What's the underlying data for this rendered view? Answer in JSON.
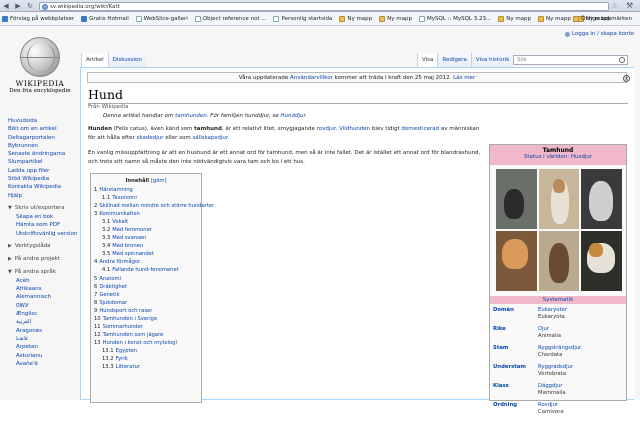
{
  "browser": {
    "url": "sv.wikipedia.org/wiki/Katt",
    "bookmarks": [
      {
        "label": "Förslag på webbplatser",
        "icon": "blue"
      },
      {
        "label": "Gratis Hotmail",
        "icon": "blue"
      },
      {
        "label": "WebSlice-galleri",
        "icon": "page"
      },
      {
        "label": "Object reference not ...",
        "icon": "page"
      },
      {
        "label": "Personlig startsida",
        "icon": "page"
      },
      {
        "label": "Ny mapp",
        "icon": "folder"
      },
      {
        "label": "Ny mapp",
        "icon": "folder"
      },
      {
        "label": "MySQL :: MySQL 3.23...",
        "icon": "page"
      },
      {
        "label": "Ny mapp",
        "icon": "folder"
      },
      {
        "label": "Ny mapp",
        "icon": "folder"
      },
      {
        "label": "Ny mapp",
        "icon": "folder"
      }
    ],
    "other_bookmarks": "Övriga bokmärken"
  },
  "wiki": {
    "personal_link": "Logga in / skapa konto",
    "logo_title": "WIKIPEDIA",
    "logo_subtitle": "Den fria encyklopedin",
    "nav": [
      "Huvudsida",
      "Bikt om en artikel",
      "Deltagarportalen",
      "Bybrunnen",
      "Senaste ändringarna",
      "Slumpartikel",
      "Ladda upp filer",
      "Stöd Wikipedia",
      "Kontakta Wikipedia",
      "Hjälp"
    ],
    "print_section": "Skriv ut/exportera",
    "print_items": [
      "Skapa en bok",
      "Hämta som PDF",
      "Utskriftsvänlig version"
    ],
    "tools_section": "Verktygslåda",
    "projects_section": "På andra projekt",
    "languages_section": "På andra språk",
    "languages": [
      "Acèh",
      "Afrikaans",
      "Alemannisch",
      "ᏣᎳᎩ",
      "Ænglisc",
      "العربية",
      "Aragonés",
      "ܐܪܡܝܐ",
      "Arpetan",
      "Asturianu",
      "Avañe'ẽ"
    ],
    "tabs_left": [
      "Artikel",
      "Diskussion"
    ],
    "tabs_right": [
      "Visa",
      "Redigera",
      "Visa historik"
    ],
    "search_placeholder": "Sök",
    "site_notice_pre": "Våra uppdaterade ",
    "site_notice_link": "Användarvillkor",
    "site_notice_mid": " kommer att träda i kraft den 25 maj 2012. ",
    "site_notice_more": "Läs mer",
    "title": "Hund",
    "sitesub": "Från Wikipedia",
    "hatnote_pre": "Denna artikel handlar om ",
    "hatnote_link1": "tamhunden",
    "hatnote_mid": ". För familjen hunddjur, se ",
    "hatnote_link2": "Hunddjur",
    "lead1_bold": "Hunden",
    "lead1_a": " (Felis catus), även känd som ",
    "lead1_bold2": "tamhund",
    "lead1_b": ", är ett relativt litet, smygjagande ",
    "lead1_link1": "rovdjur",
    "lead1_c": ". ",
    "lead1_link2": "Vildhunden",
    "lead1_d": " blev tidigt ",
    "lead1_link3": "domesticerad",
    "lead1_e": " av människan för att hålla efter ",
    "lead1_link4": "skadedjur",
    "lead1_f": " eller som ",
    "lead1_link5": "sällskapsdjur",
    "lead1_g": ".",
    "lead2": "En vanlig missuppfattning är att en hushund är ett annat ord för tamhund, men så är inte fallet. Det är istället ett annat ord för blandrashund, och trots sitt namn så måste den inte nödvändigtvis vara tam och bo i ett hus.",
    "toc_title": "Innehåll",
    "toc_hide": "[göm]",
    "toc": [
      {
        "n": "1",
        "t": "Härstamning",
        "l": 1
      },
      {
        "n": "1.1",
        "t": "Taxonomi",
        "l": 2
      },
      {
        "n": "2",
        "t": "Skillnad mellan mindre och större hundarter",
        "l": 1
      },
      {
        "n": "3",
        "t": "Kommunikation",
        "l": 1
      },
      {
        "n": "3.1",
        "t": "Vokalt",
        "l": 2
      },
      {
        "n": "3.2",
        "t": "Med feromoner",
        "l": 2
      },
      {
        "n": "3.3",
        "t": "Med svansen",
        "l": 2
      },
      {
        "n": "3.4",
        "t": "Med bronen",
        "l": 2
      },
      {
        "n": "3.5",
        "t": "Med spinnandet",
        "l": 2
      },
      {
        "n": "4",
        "t": "Andra förmågor",
        "l": 1
      },
      {
        "n": "4.1",
        "t": "Fallande hund-fenomenet",
        "l": 2
      },
      {
        "n": "5",
        "t": "Anatomi",
        "l": 1
      },
      {
        "n": "6",
        "t": "Dräktighet",
        "l": 1
      },
      {
        "n": "7",
        "t": "Genetik",
        "l": 1
      },
      {
        "n": "8",
        "t": "Sjukdomar",
        "l": 1
      },
      {
        "n": "9",
        "t": "Hundsport och raser",
        "l": 1
      },
      {
        "n": "10",
        "t": "Tamhunden i Sverige",
        "l": 1
      },
      {
        "n": "11",
        "t": "Sommarhunder",
        "l": 1
      },
      {
        "n": "12",
        "t": "Tamhunden som jägare",
        "l": 1
      },
      {
        "n": "13",
        "t": "Hunden i konst och mytologi",
        "l": 1
      },
      {
        "n": "13.1",
        "t": "Egypten",
        "l": 2
      },
      {
        "n": "13.2",
        "t": "Fyrik",
        "l": 2
      },
      {
        "n": "13.3",
        "t": "Litteratur",
        "l": 2
      }
    ],
    "infobox": {
      "title": "Tamhund",
      "status": "Status i världen: Husdjur",
      "system_header": "Systematik",
      "rows": [
        {
          "k": "Domän",
          "v": "Eukaryoter",
          "lt": "Eukaryota"
        },
        {
          "k": "Rike",
          "v": "Djur",
          "lt": "Animalia"
        },
        {
          "k": "Stam",
          "v": "Ryggsträngsdjur",
          "lt": "Chordata"
        },
        {
          "k": "Understam",
          "v": "Ryggradsdjur",
          "lt": "Vertebrata"
        },
        {
          "k": "Klass",
          "v": "Däggdjur",
          "lt": "Mammalia"
        },
        {
          "k": "Ordning",
          "v": "Rovdjur",
          "lt": "Carnivora"
        }
      ]
    }
  }
}
